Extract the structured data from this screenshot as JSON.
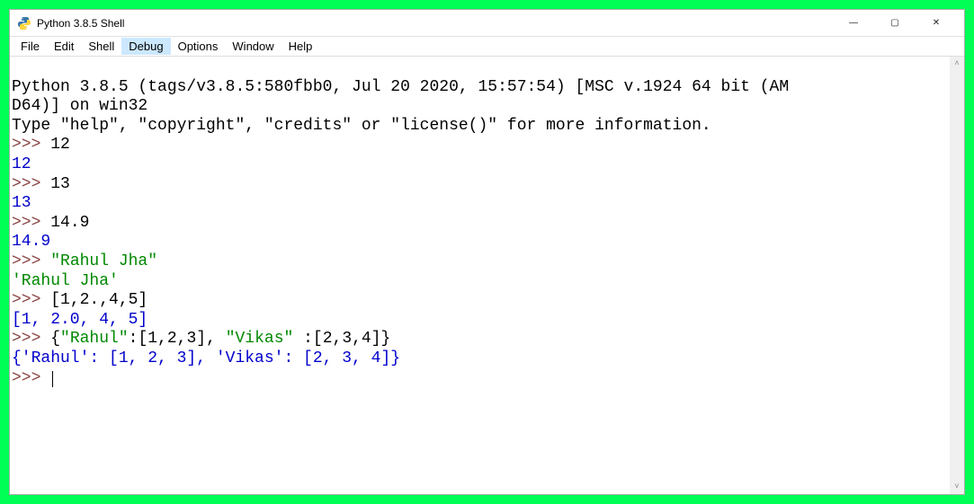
{
  "window": {
    "title": "Python 3.8.5 Shell"
  },
  "winControls": {
    "minimize": "—",
    "maximize": "▢",
    "close": "✕"
  },
  "menu": {
    "file": "File",
    "edit": "Edit",
    "shell": "Shell",
    "debug": "Debug",
    "options": "Options",
    "window": "Window",
    "help": "Help"
  },
  "shell": {
    "banner1": "Python 3.8.5 (tags/v3.8.5:580fbb0, Jul 20 2020, 15:57:54) [MSC v.1924 64 bit (AM",
    "banner2": "D64)] on win32",
    "banner3": "Type \"help\", \"copyright\", \"credits\" or \"license()\" for more information.",
    "prompt": ">>> ",
    "in1": "12",
    "out1": "12",
    "in2": "13",
    "out2": "13",
    "in3": "14.9",
    "out3": "14.9",
    "in4": "\"Rahul Jha\"",
    "out4": "'Rahul Jha'",
    "in5": "[1,2.,4,5]",
    "out5": "[1, 2.0, 4, 5]",
    "in6a": "{",
    "in6b": "\"Rahul\"",
    "in6c": ":[1,2,3], ",
    "in6d": "\"Vikas\"",
    "in6e": " :[2,3,4]}",
    "out6": "{'Rahul': [1, 2, 3], 'Vikas': [2, 3, 4]}"
  },
  "scroll": {
    "up": "˄",
    "down": "˅"
  }
}
